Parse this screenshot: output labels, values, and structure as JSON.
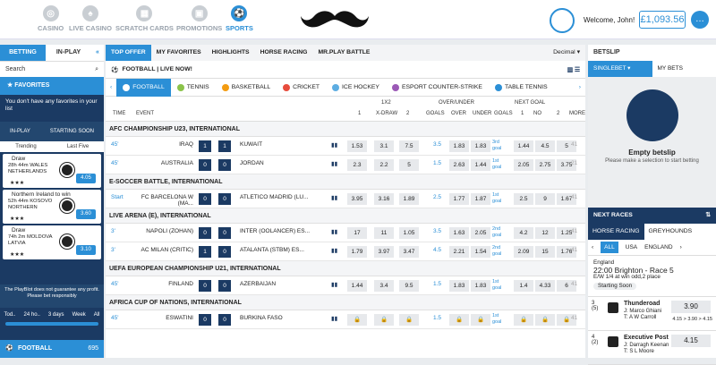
{
  "header": {
    "nav": [
      "CASINO",
      "LIVE CASINO",
      "SCRATCH CARDS",
      "PROMOTIONS",
      "SPORTS"
    ],
    "welcome": "Welcome, John!",
    "balance": "£1,093.56"
  },
  "left": {
    "tabs": [
      "BETTING",
      "IN-PLAY"
    ],
    "search": "Search",
    "favorites": "FAVORITES",
    "fav_msg": "You don't have any favorites in your list",
    "mini": [
      "IN-PLAY",
      "STARTING SOON"
    ],
    "sub": [
      "Trending",
      "Last Five"
    ],
    "cards": [
      {
        "label": "Draw",
        "time": "28h 44m",
        "teams": "WALES\nNETHERLANDS",
        "odd": "4.05"
      },
      {
        "label": "Northern Ireland to win",
        "time": "52h 44m",
        "teams": "KOSOVO\nNORTHERN",
        "odd": "3.60"
      },
      {
        "label": "Draw",
        "time": "74h 2m",
        "teams": "MOLDOVA\nLATVIA",
        "odd": "3.10"
      },
      {
        "label": "Draw",
        "time": "",
        "teams": "",
        "odd": ""
      }
    ],
    "disclaimer": "The PlayBlot does not guarantee any profit. Please bet responsibly",
    "time": [
      "Tod..",
      "24 ho..",
      "3 days",
      "Week",
      "All"
    ],
    "football": "FOOTBALL",
    "football_count": "695"
  },
  "main": {
    "tabs": [
      "TOP OFFER",
      "MY FAVORITES",
      "HIGHLIGHTS",
      "HORSE RACING",
      "MR.PLAY BATTLE"
    ],
    "decimal": "Decimal",
    "live": "FOOTBALL | LIVE NOW!",
    "sports": [
      "FOOTBALL",
      "TENNIS",
      "BASKETBALL",
      "CRICKET",
      "ICE HOCKEY",
      "ESPORT COUNTER-STRIKE",
      "TABLE TENNIS"
    ],
    "cols": {
      "time": "TIME",
      "event": "EVENT",
      "g1": "1X2",
      "g2": "OVER/UNDER",
      "g3": "NEXT GOAL",
      "c1": "1",
      "cx": "X-DRAW",
      "c2": "2",
      "goals": "GOALS",
      "over": "OVER",
      "under": "UNDER",
      "goals2": "GOALS",
      "n1": "1",
      "no": "NO",
      "n2": "2",
      "more": "MORE"
    },
    "sections": [
      {
        "name": "AFC CHAMPIONSHIP U23, INTERNATIONAL",
        "rows": [
          [
            "45'",
            "IRAQ",
            "1",
            "1",
            "KUWAIT",
            "1.53",
            "3.1",
            "7.5",
            "3.5",
            "1.83",
            "1.83",
            "3rd goal",
            "1.44",
            "4.5",
            "5",
            "41"
          ],
          [
            "45'",
            "AUSTRALIA",
            "0",
            "0",
            "JORDAN",
            "2.3",
            "2.2",
            "5",
            "1.5",
            "2.63",
            "1.44",
            "1st goal",
            "2.05",
            "2.75",
            "3.75",
            "21"
          ]
        ]
      },
      {
        "name": "E-SOCCER BATTLE, INTERNATIONAL",
        "rows": [
          [
            "Start",
            "FC BARCELONA W (MA...",
            "0",
            "0",
            "ATLETICO MADRID (LU...",
            "3.95",
            "3.16",
            "1.89",
            "2.5",
            "1.77",
            "1.87",
            "1st goal",
            "2.5",
            "9",
            "1.67",
            "41"
          ]
        ]
      },
      {
        "name": "LIVE ARENA (E), INTERNATIONAL",
        "rows": [
          [
            "3'",
            "NAPOLI (ZOHAN)",
            "0",
            "0",
            "INTER (OOLANCER) ES...",
            "17",
            "11",
            "1.05",
            "3.5",
            "1.63",
            "2.05",
            "2nd goal",
            "4.2",
            "12",
            "1.25",
            "41"
          ],
          [
            "3'",
            "AC MILAN (CRITIC)",
            "1",
            "0",
            "ATALANTA (STBM) ES...",
            "1.79",
            "3.97",
            "3.47",
            "4.5",
            "2.21",
            "1.54",
            "2nd goal",
            "2.09",
            "15",
            "1.76",
            "41"
          ]
        ]
      },
      {
        "name": "UEFA EUROPEAN CHAMPIONSHIP U21, INTERNATIONAL",
        "rows": [
          [
            "45'",
            "FINLAND",
            "0",
            "0",
            "AZERBAIJAN",
            "1.44",
            "3.4",
            "9.5",
            "1.5",
            "1.83",
            "1.83",
            "1st goal",
            "1.4",
            "4.33",
            "6",
            "41"
          ]
        ]
      },
      {
        "name": "AFRICA CUP OF NATIONS, INTERNATIONAL",
        "rows": [
          [
            "45'",
            "ESWATINI",
            "0",
            "0",
            "BURKINA FASO",
            "",
            "",
            "",
            "1.5",
            "",
            "",
            "1st goal",
            "",
            "",
            "",
            "41"
          ]
        ]
      }
    ]
  },
  "right": {
    "betslip": "BETSLIP",
    "tabs": [
      "SINGLEBET",
      "MY BETS"
    ],
    "empty": "Empty betslip",
    "empty_msg": "Please make a selection to start betting",
    "next": "NEXT RACES",
    "race_tabs": [
      "HORSE RACING",
      "GREYHOUNDS"
    ],
    "flags": [
      "ALL",
      "USA",
      "ENGLAND"
    ],
    "race": {
      "country": "England",
      "title": "22:00 Brighton - Race 5",
      "info": "E/W 1/4 at win odd,2 place",
      "status": "Starting Soon"
    },
    "runners": [
      {
        "pos": "3\n(5)",
        "name": "Thunderoad",
        "j": "J: Marco Ghiani\nT: A W Carroll",
        "price": "3.90",
        "hist": "4.15 > 3.90 > 4.15"
      },
      {
        "pos": "4\n(2)",
        "name": "Executive Post",
        "j": "J: Darragh Keenan\nT: S L Moore",
        "price": "4.15",
        "hist": ""
      }
    ]
  },
  "colors": {
    "accent": "#2b8fd6",
    "navy": "#1b3a63"
  }
}
